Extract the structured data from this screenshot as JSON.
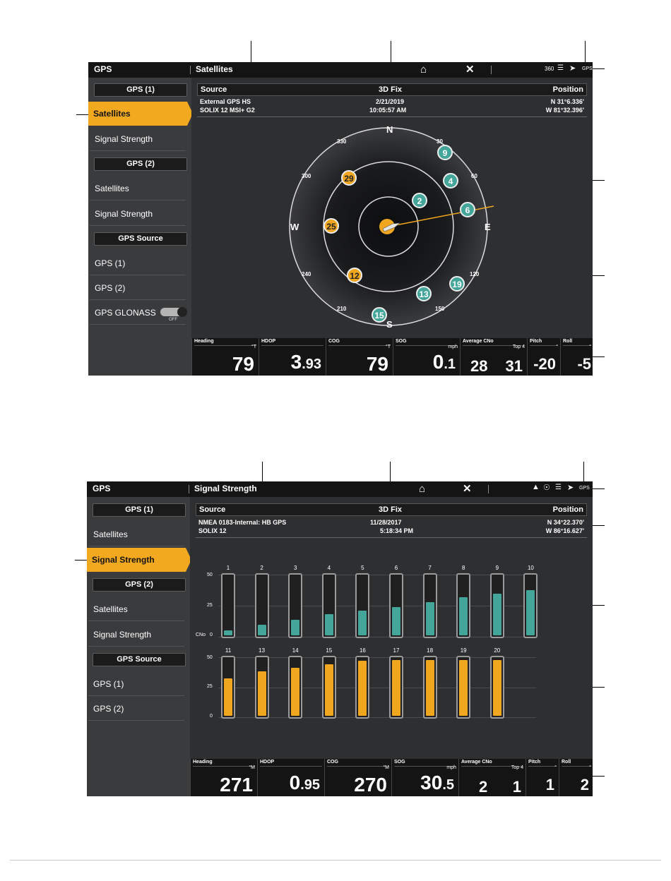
{
  "screen1": {
    "topbar": {
      "app_title": "GPS",
      "view_title": "Satellites",
      "home_icon": "home-icon",
      "close_icon": "close-icon",
      "status_360": "360",
      "status_gps": "GPS"
    },
    "sidebar": {
      "gps1_header": "GPS (1)",
      "gps1_satellites": "Satellites",
      "gps1_signal": "Signal Strength",
      "gps2_header": "GPS (2)",
      "gps2_satellites": "Satellites",
      "gps2_signal": "Signal Strength",
      "source_header": "GPS Source",
      "source_gps1": "GPS (1)",
      "source_gps2": "GPS (2)",
      "glonass_label": "GPS GLONASS",
      "glonass_state": "OFF"
    },
    "info": {
      "h_source": "Source",
      "h_fix": "3D Fix",
      "h_position": "Position",
      "source1": "External GPS HS",
      "date": "2/21/2019",
      "lat": "N 31°6.336'",
      "source2": "SOLIX 12 MSI+ G2",
      "time": "10:05:57 AM",
      "lon": "W 81°32.396'"
    },
    "compass": {
      "n": "N",
      "s": "S",
      "e": "E",
      "w": "W",
      "degrees": {
        "d30": "30",
        "d60": "60",
        "d120": "120",
        "d150": "150",
        "d210": "210",
        "d240": "240",
        "d300": "300",
        "d330": "330"
      },
      "sats": {
        "s9": "9",
        "s4": "4",
        "s29": "29",
        "s2": "2",
        "s6": "6",
        "s25": "25",
        "s12": "12",
        "s19": "19",
        "s13": "13",
        "s15": "15"
      }
    },
    "bottom": {
      "heading_label": "Heading",
      "heading_unit": "°T",
      "heading_value": "79",
      "hdop_label": "HDOP",
      "hdop_int": "3",
      "hdop_dec": ".93",
      "cog_label": "COG",
      "cog_unit": "°T",
      "cog_value": "79",
      "sog_label": "SOG",
      "sog_unit": "mph",
      "sog_int": "0",
      "sog_dec": ".1",
      "cno_label": "Average CNo",
      "cno_top": "Top 4",
      "cno_v1": "28",
      "cno_v2": "31",
      "pitch_label": "Pitch",
      "pitch_unit": "°",
      "pitch_value": "-20",
      "roll_label": "Roll",
      "roll_unit": "°",
      "roll_value": "-5"
    }
  },
  "screen2": {
    "topbar": {
      "app_title": "GPS",
      "view_title": "Signal Strength",
      "home_icon": "home-icon",
      "close_icon": "close-icon",
      "status_gps": "GPS"
    },
    "sidebar": {
      "gps1_header": "GPS (1)",
      "gps1_satellites": "Satellites",
      "gps1_signal": "Signal Strength",
      "gps2_header": "GPS (2)",
      "gps2_satellites": "Satellites",
      "gps2_signal": "Signal Strength",
      "source_header": "GPS Source",
      "source_gps1": "GPS (1)",
      "source_gps2": "GPS (2)"
    },
    "info": {
      "h_source": "Source",
      "h_fix": "3D Fix",
      "h_position": "Position",
      "source1": "NMEA 0183-Internal: HB GPS",
      "date": "11/28/2017",
      "lat": "N 34°22.370'",
      "source2": "SOLIX 12",
      "time": "5:18:34 PM",
      "lon": "W 86°16.627'"
    },
    "signal": {
      "axis": {
        "top": "50",
        "mid": "25",
        "bottom": "0",
        "cno": "CNo"
      },
      "row1": [
        {
          "id": "1",
          "level": 4
        },
        {
          "id": "2",
          "level": 9
        },
        {
          "id": "3",
          "level": 13
        },
        {
          "id": "4",
          "level": 18
        },
        {
          "id": "5",
          "level": 21
        },
        {
          "id": "6",
          "level": 24
        },
        {
          "id": "7",
          "level": 28
        },
        {
          "id": "8",
          "level": 32
        },
        {
          "id": "9",
          "level": 35
        },
        {
          "id": "10",
          "level": 38
        }
      ],
      "row2": [
        {
          "id": "11",
          "level": 33
        },
        {
          "id": "13",
          "level": 39
        },
        {
          "id": "14",
          "level": 42
        },
        {
          "id": "15",
          "level": 45
        },
        {
          "id": "16",
          "level": 48
        },
        {
          "id": "17",
          "level": 49
        },
        {
          "id": "18",
          "level": 49
        },
        {
          "id": "19",
          "level": 49
        },
        {
          "id": "20",
          "level": 49
        }
      ],
      "colors": {
        "row1": "#44a69a",
        "row2": "#f0a61f"
      }
    },
    "bottom": {
      "heading_label": "Heading",
      "heading_unit": "°M",
      "heading_value": "271",
      "hdop_label": "HDOP",
      "hdop_int": "0",
      "hdop_dec": ".95",
      "cog_label": "COG",
      "cog_unit": "°M",
      "cog_value": "270",
      "sog_label": "SOG",
      "sog_unit": "mph",
      "sog_int": "30",
      "sog_dec": ".5",
      "cno_label": "Average CNo",
      "cno_top": "Top 4",
      "cno_v1": "2",
      "cno_v2": "1",
      "pitch_label": "Pitch",
      "pitch_unit": "°",
      "pitch_value": "1",
      "roll_label": "Roll",
      "roll_unit": "°",
      "roll_value": "2"
    }
  }
}
